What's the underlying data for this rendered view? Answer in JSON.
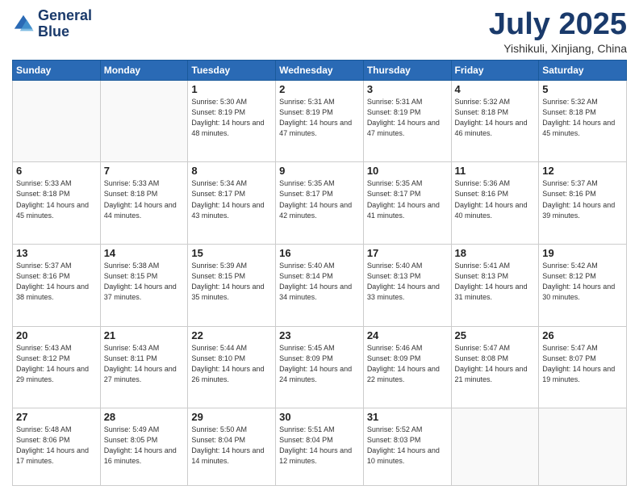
{
  "header": {
    "logo_line1": "General",
    "logo_line2": "Blue",
    "month": "July 2025",
    "location": "Yishikuli, Xinjiang, China"
  },
  "weekdays": [
    "Sunday",
    "Monday",
    "Tuesday",
    "Wednesday",
    "Thursday",
    "Friday",
    "Saturday"
  ],
  "weeks": [
    [
      {
        "day": "",
        "sunrise": "",
        "sunset": "",
        "daylight": ""
      },
      {
        "day": "",
        "sunrise": "",
        "sunset": "",
        "daylight": ""
      },
      {
        "day": "1",
        "sunrise": "Sunrise: 5:30 AM",
        "sunset": "Sunset: 8:19 PM",
        "daylight": "Daylight: 14 hours and 48 minutes."
      },
      {
        "day": "2",
        "sunrise": "Sunrise: 5:31 AM",
        "sunset": "Sunset: 8:19 PM",
        "daylight": "Daylight: 14 hours and 47 minutes."
      },
      {
        "day": "3",
        "sunrise": "Sunrise: 5:31 AM",
        "sunset": "Sunset: 8:19 PM",
        "daylight": "Daylight: 14 hours and 47 minutes."
      },
      {
        "day": "4",
        "sunrise": "Sunrise: 5:32 AM",
        "sunset": "Sunset: 8:18 PM",
        "daylight": "Daylight: 14 hours and 46 minutes."
      },
      {
        "day": "5",
        "sunrise": "Sunrise: 5:32 AM",
        "sunset": "Sunset: 8:18 PM",
        "daylight": "Daylight: 14 hours and 45 minutes."
      }
    ],
    [
      {
        "day": "6",
        "sunrise": "Sunrise: 5:33 AM",
        "sunset": "Sunset: 8:18 PM",
        "daylight": "Daylight: 14 hours and 45 minutes."
      },
      {
        "day": "7",
        "sunrise": "Sunrise: 5:33 AM",
        "sunset": "Sunset: 8:18 PM",
        "daylight": "Daylight: 14 hours and 44 minutes."
      },
      {
        "day": "8",
        "sunrise": "Sunrise: 5:34 AM",
        "sunset": "Sunset: 8:17 PM",
        "daylight": "Daylight: 14 hours and 43 minutes."
      },
      {
        "day": "9",
        "sunrise": "Sunrise: 5:35 AM",
        "sunset": "Sunset: 8:17 PM",
        "daylight": "Daylight: 14 hours and 42 minutes."
      },
      {
        "day": "10",
        "sunrise": "Sunrise: 5:35 AM",
        "sunset": "Sunset: 8:17 PM",
        "daylight": "Daylight: 14 hours and 41 minutes."
      },
      {
        "day": "11",
        "sunrise": "Sunrise: 5:36 AM",
        "sunset": "Sunset: 8:16 PM",
        "daylight": "Daylight: 14 hours and 40 minutes."
      },
      {
        "day": "12",
        "sunrise": "Sunrise: 5:37 AM",
        "sunset": "Sunset: 8:16 PM",
        "daylight": "Daylight: 14 hours and 39 minutes."
      }
    ],
    [
      {
        "day": "13",
        "sunrise": "Sunrise: 5:37 AM",
        "sunset": "Sunset: 8:16 PM",
        "daylight": "Daylight: 14 hours and 38 minutes."
      },
      {
        "day": "14",
        "sunrise": "Sunrise: 5:38 AM",
        "sunset": "Sunset: 8:15 PM",
        "daylight": "Daylight: 14 hours and 37 minutes."
      },
      {
        "day": "15",
        "sunrise": "Sunrise: 5:39 AM",
        "sunset": "Sunset: 8:15 PM",
        "daylight": "Daylight: 14 hours and 35 minutes."
      },
      {
        "day": "16",
        "sunrise": "Sunrise: 5:40 AM",
        "sunset": "Sunset: 8:14 PM",
        "daylight": "Daylight: 14 hours and 34 minutes."
      },
      {
        "day": "17",
        "sunrise": "Sunrise: 5:40 AM",
        "sunset": "Sunset: 8:13 PM",
        "daylight": "Daylight: 14 hours and 33 minutes."
      },
      {
        "day": "18",
        "sunrise": "Sunrise: 5:41 AM",
        "sunset": "Sunset: 8:13 PM",
        "daylight": "Daylight: 14 hours and 31 minutes."
      },
      {
        "day": "19",
        "sunrise": "Sunrise: 5:42 AM",
        "sunset": "Sunset: 8:12 PM",
        "daylight": "Daylight: 14 hours and 30 minutes."
      }
    ],
    [
      {
        "day": "20",
        "sunrise": "Sunrise: 5:43 AM",
        "sunset": "Sunset: 8:12 PM",
        "daylight": "Daylight: 14 hours and 29 minutes."
      },
      {
        "day": "21",
        "sunrise": "Sunrise: 5:43 AM",
        "sunset": "Sunset: 8:11 PM",
        "daylight": "Daylight: 14 hours and 27 minutes."
      },
      {
        "day": "22",
        "sunrise": "Sunrise: 5:44 AM",
        "sunset": "Sunset: 8:10 PM",
        "daylight": "Daylight: 14 hours and 26 minutes."
      },
      {
        "day": "23",
        "sunrise": "Sunrise: 5:45 AM",
        "sunset": "Sunset: 8:09 PM",
        "daylight": "Daylight: 14 hours and 24 minutes."
      },
      {
        "day": "24",
        "sunrise": "Sunrise: 5:46 AM",
        "sunset": "Sunset: 8:09 PM",
        "daylight": "Daylight: 14 hours and 22 minutes."
      },
      {
        "day": "25",
        "sunrise": "Sunrise: 5:47 AM",
        "sunset": "Sunset: 8:08 PM",
        "daylight": "Daylight: 14 hours and 21 minutes."
      },
      {
        "day": "26",
        "sunrise": "Sunrise: 5:47 AM",
        "sunset": "Sunset: 8:07 PM",
        "daylight": "Daylight: 14 hours and 19 minutes."
      }
    ],
    [
      {
        "day": "27",
        "sunrise": "Sunrise: 5:48 AM",
        "sunset": "Sunset: 8:06 PM",
        "daylight": "Daylight: 14 hours and 17 minutes."
      },
      {
        "day": "28",
        "sunrise": "Sunrise: 5:49 AM",
        "sunset": "Sunset: 8:05 PM",
        "daylight": "Daylight: 14 hours and 16 minutes."
      },
      {
        "day": "29",
        "sunrise": "Sunrise: 5:50 AM",
        "sunset": "Sunset: 8:04 PM",
        "daylight": "Daylight: 14 hours and 14 minutes."
      },
      {
        "day": "30",
        "sunrise": "Sunrise: 5:51 AM",
        "sunset": "Sunset: 8:04 PM",
        "daylight": "Daylight: 14 hours and 12 minutes."
      },
      {
        "day": "31",
        "sunrise": "Sunrise: 5:52 AM",
        "sunset": "Sunset: 8:03 PM",
        "daylight": "Daylight: 14 hours and 10 minutes."
      },
      {
        "day": "",
        "sunrise": "",
        "sunset": "",
        "daylight": ""
      },
      {
        "day": "",
        "sunrise": "",
        "sunset": "",
        "daylight": ""
      }
    ]
  ]
}
